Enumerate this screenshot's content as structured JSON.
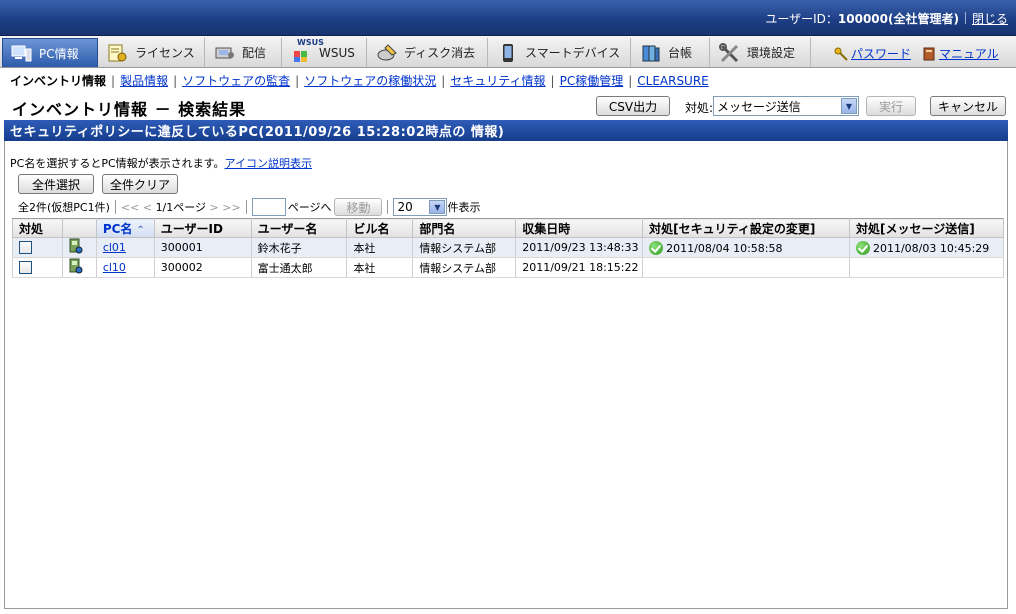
{
  "header": {
    "user_label": "ユーザーID：",
    "user_id": "100000(全社管理者)",
    "close_link": "閉じる"
  },
  "tabs": [
    {
      "label": "PC情報",
      "icon": "pc-info-icon",
      "active": true
    },
    {
      "label": "ライセンス",
      "icon": "license-icon"
    },
    {
      "label": "配信",
      "icon": "distribution-icon"
    },
    {
      "label": "WSUS",
      "icon": "wsus-icon",
      "sup": "WSUS"
    },
    {
      "label": "ディスク消去",
      "icon": "disk-erase-icon"
    },
    {
      "label": "スマートデバイス",
      "icon": "smart-device-icon"
    },
    {
      "label": "台帳",
      "icon": "ledger-icon"
    },
    {
      "label": "環境設定",
      "icon": "settings-tools-icon"
    }
  ],
  "top_links": {
    "password": "パスワード",
    "manual": "マニュアル"
  },
  "subnav": {
    "current": "インベントリ情報",
    "links": [
      "製品情報",
      "ソフトウェアの監査",
      "ソフトウェアの稼働状況",
      "セキュリティ情報",
      "PC稼働管理",
      "CLEARSURE"
    ]
  },
  "page_title": "インベントリ情報 － 検索結果",
  "toolbar": {
    "csv_button": "CSV出力",
    "action_label": "対処:",
    "action_select": "メッセージ送信",
    "run_button": "実行",
    "cancel_button": "キャンセル"
  },
  "section_title": "セキュリティポリシーに違反しているPC(2011/09/26 15:28:02時点の 情報)",
  "hint": {
    "text": "PC名を選択するとPC情報が表示されます。",
    "link": "アイコン説明表示"
  },
  "buttons": {
    "select_all": "全件選択",
    "clear_all": "全件クリア"
  },
  "pager": {
    "summary": "全2件(仮想PC1件)",
    "first": "<<",
    "prev": "<",
    "page_info": "1/1ページ",
    "next": ">",
    "last": ">>",
    "page_input": "",
    "goto_label": "ページへ",
    "move_button": "移動",
    "per_page": "20",
    "per_page_label": "件表示"
  },
  "table": {
    "headers": [
      "対処",
      "",
      "PC名",
      "ユーザーID",
      "ユーザー名",
      "ビル名",
      "部門名",
      "収集日時",
      "対処[セキュリティ設定の変更]",
      "対処[メッセージ送信]"
    ],
    "rows": [
      {
        "pc": "cl01",
        "user_id": "300001",
        "user_name": "鈴木花子",
        "building": "本社",
        "dept": "情報システム部",
        "collected": "2011/09/23 13:48:33",
        "security_change": "2011/08/04 10:58:58",
        "message_sent": "2011/08/03 10:45:29"
      },
      {
        "pc": "cl10",
        "user_id": "300002",
        "user_name": "富士通太郎",
        "building": "本社",
        "dept": "情報システム部",
        "collected": "2011/09/21 18:15:22",
        "security_change": "",
        "message_sent": ""
      }
    ]
  },
  "colors": {
    "header_blue": "#1e3f86",
    "section_blue": "#153d8c",
    "row_highlight": "#e8edf6",
    "link": "#0033cc"
  }
}
